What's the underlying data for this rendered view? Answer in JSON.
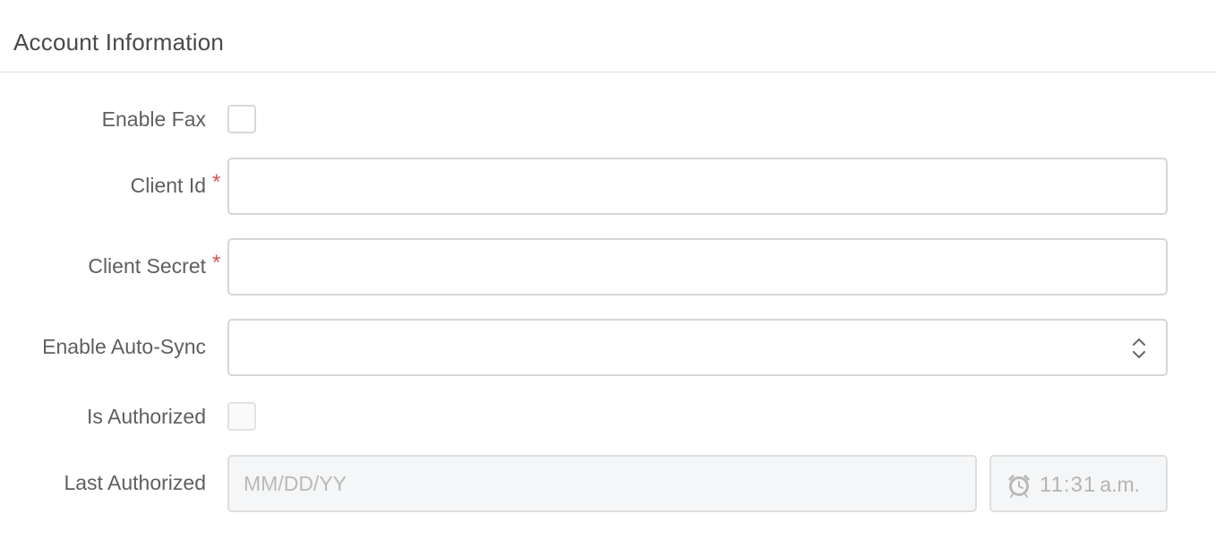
{
  "section": {
    "title": "Account Information"
  },
  "form": {
    "enable_fax": {
      "label": "Enable Fax",
      "checked": false
    },
    "client_id": {
      "label": "Client Id",
      "required_mark": "*",
      "value": ""
    },
    "client_secret": {
      "label": "Client Secret",
      "required_mark": "*",
      "value": ""
    },
    "enable_auto_sync": {
      "label": "Enable Auto-Sync",
      "value": ""
    },
    "is_authorized": {
      "label": "Is Authorized",
      "checked": false
    },
    "last_authorized": {
      "label": "Last Authorized",
      "date_placeholder": "MM/DD/YY",
      "time_value": "11:31",
      "time_suffix": "a.m."
    }
  },
  "colors": {
    "required": "#d9534f",
    "border": "#d6d6d6",
    "disabled_bg": "#f5f6f7"
  },
  "icons": {
    "select_chevron": "chevron-up-down-icon",
    "time": "alarm-clock-icon"
  }
}
